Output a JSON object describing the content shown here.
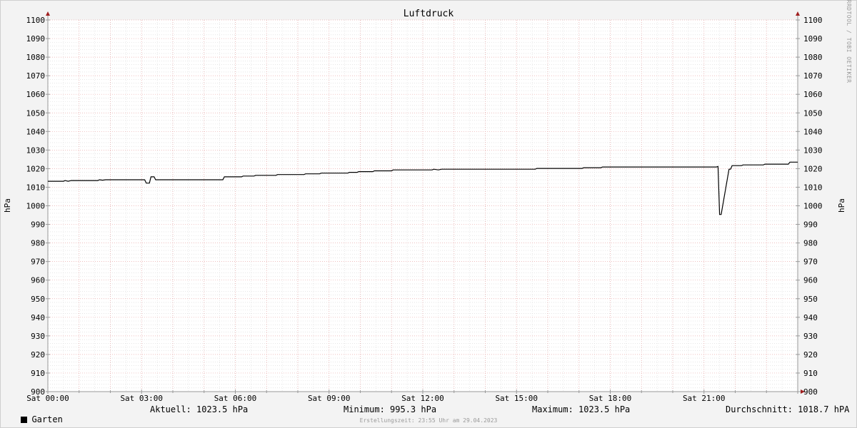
{
  "chart_data": {
    "type": "line",
    "title": "Luftdruck",
    "ylabel_left": "hPa",
    "ylabel_right": "hPa",
    "ylim": [
      900,
      1100
    ],
    "y_ticks": [
      "900",
      "910",
      "920",
      "930",
      "940",
      "950",
      "960",
      "970",
      "980",
      "990",
      "1000",
      "1010",
      "1020",
      "1030",
      "1040",
      "1050",
      "1060",
      "1070",
      "1080",
      "1090",
      "1100"
    ],
    "x_range_hours": [
      0,
      24
    ],
    "x_ticks": [
      {
        "hour": 0,
        "label": "Sat 00:00"
      },
      {
        "hour": 3,
        "label": "Sat 03:00"
      },
      {
        "hour": 6,
        "label": "Sat 06:00"
      },
      {
        "hour": 9,
        "label": "Sat 09:00"
      },
      {
        "hour": 12,
        "label": "Sat 12:00"
      },
      {
        "hour": 15,
        "label": "Sat 15:00"
      },
      {
        "hour": 18,
        "label": "Sat 18:00"
      },
      {
        "hour": 21,
        "label": "Sat 21:00"
      }
    ],
    "grid": true,
    "series": [
      {
        "name": "Garten",
        "color": "#000000",
        "points": [
          [
            0.0,
            1013.2
          ],
          [
            0.5,
            1013.2
          ],
          [
            0.55,
            1013.6
          ],
          [
            0.65,
            1013.2
          ],
          [
            0.75,
            1013.6
          ],
          [
            1.6,
            1013.6
          ],
          [
            1.65,
            1014.0
          ],
          [
            1.75,
            1013.8
          ],
          [
            1.85,
            1014.0
          ],
          [
            3.1,
            1014.0
          ],
          [
            3.15,
            1012.2
          ],
          [
            3.25,
            1012.2
          ],
          [
            3.3,
            1015.6
          ],
          [
            3.4,
            1015.6
          ],
          [
            3.45,
            1014.0
          ],
          [
            5.6,
            1014.0
          ],
          [
            5.65,
            1015.6
          ],
          [
            6.2,
            1015.6
          ],
          [
            6.25,
            1016.0
          ],
          [
            6.6,
            1016.0
          ],
          [
            6.65,
            1016.4
          ],
          [
            7.3,
            1016.4
          ],
          [
            7.35,
            1016.8
          ],
          [
            8.2,
            1016.8
          ],
          [
            8.25,
            1017.2
          ],
          [
            8.7,
            1017.2
          ],
          [
            8.75,
            1017.6
          ],
          [
            9.6,
            1017.6
          ],
          [
            9.65,
            1018.0
          ],
          [
            9.9,
            1018.0
          ],
          [
            9.95,
            1018.4
          ],
          [
            10.4,
            1018.4
          ],
          [
            10.45,
            1018.8
          ],
          [
            11.0,
            1018.8
          ],
          [
            11.05,
            1019.3
          ],
          [
            12.3,
            1019.3
          ],
          [
            12.35,
            1019.7
          ],
          [
            12.5,
            1019.3
          ],
          [
            12.6,
            1019.7
          ],
          [
            15.6,
            1019.7
          ],
          [
            15.65,
            1020.1
          ],
          [
            17.1,
            1020.1
          ],
          [
            17.15,
            1020.5
          ],
          [
            17.7,
            1020.5
          ],
          [
            17.75,
            1020.9
          ],
          [
            21.4,
            1020.9
          ],
          [
            21.45,
            1021.2
          ],
          [
            21.5,
            995.3
          ],
          [
            21.55,
            995.3
          ],
          [
            21.8,
            1019.7
          ],
          [
            21.85,
            1019.7
          ],
          [
            21.9,
            1021.6
          ],
          [
            22.2,
            1021.6
          ],
          [
            22.25,
            1022.0
          ],
          [
            22.9,
            1022.0
          ],
          [
            22.95,
            1022.4
          ],
          [
            23.7,
            1022.4
          ],
          [
            23.75,
            1023.5
          ],
          [
            24.0,
            1023.5
          ]
        ]
      }
    ]
  },
  "legend": {
    "series_name": "Garten"
  },
  "stats": {
    "aktuell": "Aktuell: 1023.5 hPa",
    "minimum": "Minimum: 995.3 hPa",
    "maximum": "Maximum: 1023.5 hPa",
    "durchschnitt": "Durchschnitt: 1018.7 hPA"
  },
  "created": "Erstellungszeit: 23:55 Uhr am 29.04.2023",
  "watermark": "RRDTOOL / TOBI OETIKER",
  "colors": {
    "background": "#f3f3f3",
    "plot_background": "#ffffff",
    "major_grid": "#e8a8a8",
    "minor_grid": "#d6d6d6",
    "axis": "#9a9a9a",
    "arrow": "#a02020",
    "line": "#000000"
  }
}
